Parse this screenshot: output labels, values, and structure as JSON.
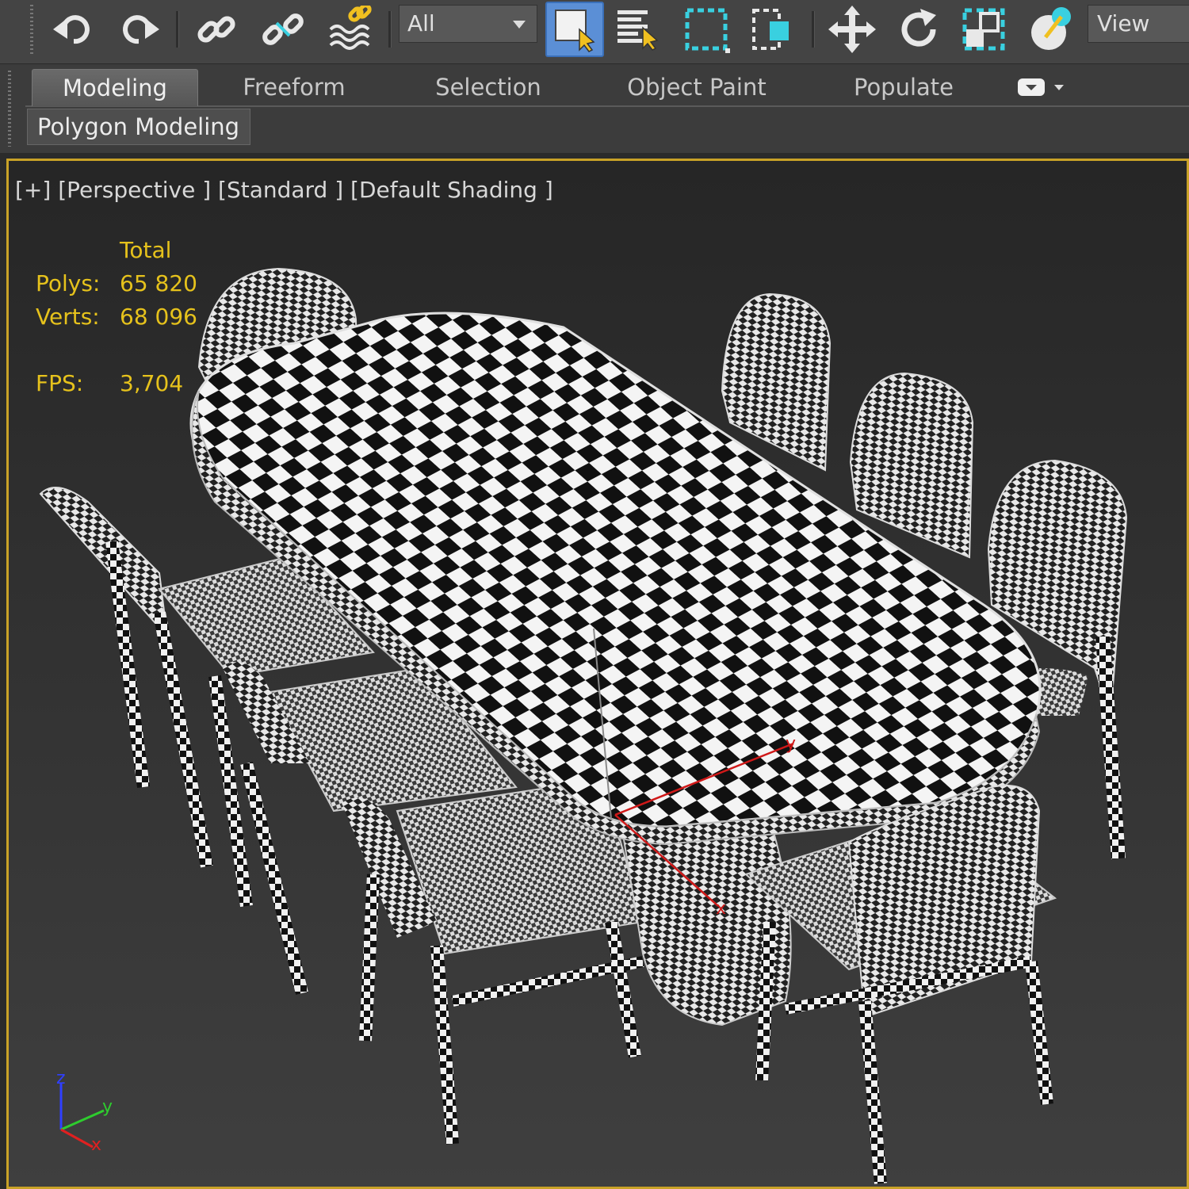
{
  "toolbar": {
    "filter_value": "All",
    "view_label": "View",
    "icons": [
      "undo-icon",
      "redo-icon",
      "link-icon",
      "unlink-icon",
      "bind-space-warp-icon",
      "select-object-icon",
      "select-by-name-icon",
      "rectangular-selection-icon",
      "window-crossing-icon",
      "move-icon",
      "rotate-icon",
      "scale-icon",
      "snaps-toggle-icon"
    ]
  },
  "ribbon": {
    "tabs": [
      {
        "label": "Modeling",
        "active": true
      },
      {
        "label": "Freeform",
        "active": false
      },
      {
        "label": "Selection",
        "active": false
      },
      {
        "label": "Object Paint",
        "active": false
      },
      {
        "label": "Populate",
        "active": false
      }
    ],
    "panel_label": "Polygon Modeling"
  },
  "viewport": {
    "label": "[+] [Perspective ] [Standard ] [Default Shading ]",
    "border_color": "#c9a227",
    "stats": {
      "header": "Total",
      "polys_label": "Polys:",
      "polys_value": "65 820",
      "verts_label": "Verts:",
      "verts_value": "68 096",
      "fps_label": "FPS:",
      "fps_value": "3,704",
      "color": "#e6c21c"
    },
    "gizmo": {
      "x": "x",
      "y": "y",
      "z": "z"
    },
    "axis_tripod": {
      "x": "x",
      "y": "y",
      "z": "z"
    }
  }
}
